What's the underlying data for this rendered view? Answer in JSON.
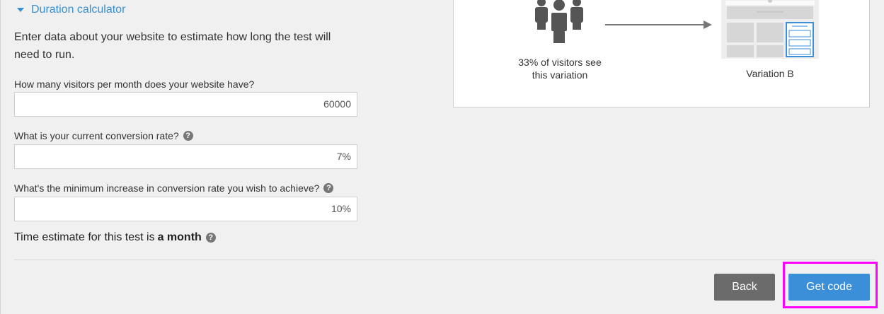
{
  "calculator": {
    "title": "Duration calculator",
    "intro": "Enter data about your website to estimate how long the test will need to run."
  },
  "questions": [
    {
      "label": "How many visitors per month does your website have?",
      "value": "60000",
      "has_help": false
    },
    {
      "label": "What is your current conversion rate?",
      "value": "7%",
      "has_help": true
    },
    {
      "label": "What's the minimum increase in conversion rate you wish to achieve?",
      "value": "10%",
      "has_help": true
    }
  ],
  "estimate": {
    "prefix": "Time estimate for this test is",
    "value": "a month"
  },
  "illustration": {
    "caption_line1": "33% of visitors see",
    "caption_line2": "this variation",
    "variation_label": "Variation B"
  },
  "buttons": {
    "back": "Back",
    "get_code": "Get code"
  },
  "colors": {
    "link_blue": "#3a8fd0",
    "primary_button": "#3a8fd8",
    "back_button": "#6b6b6b",
    "highlight": "#ff00ff"
  }
}
